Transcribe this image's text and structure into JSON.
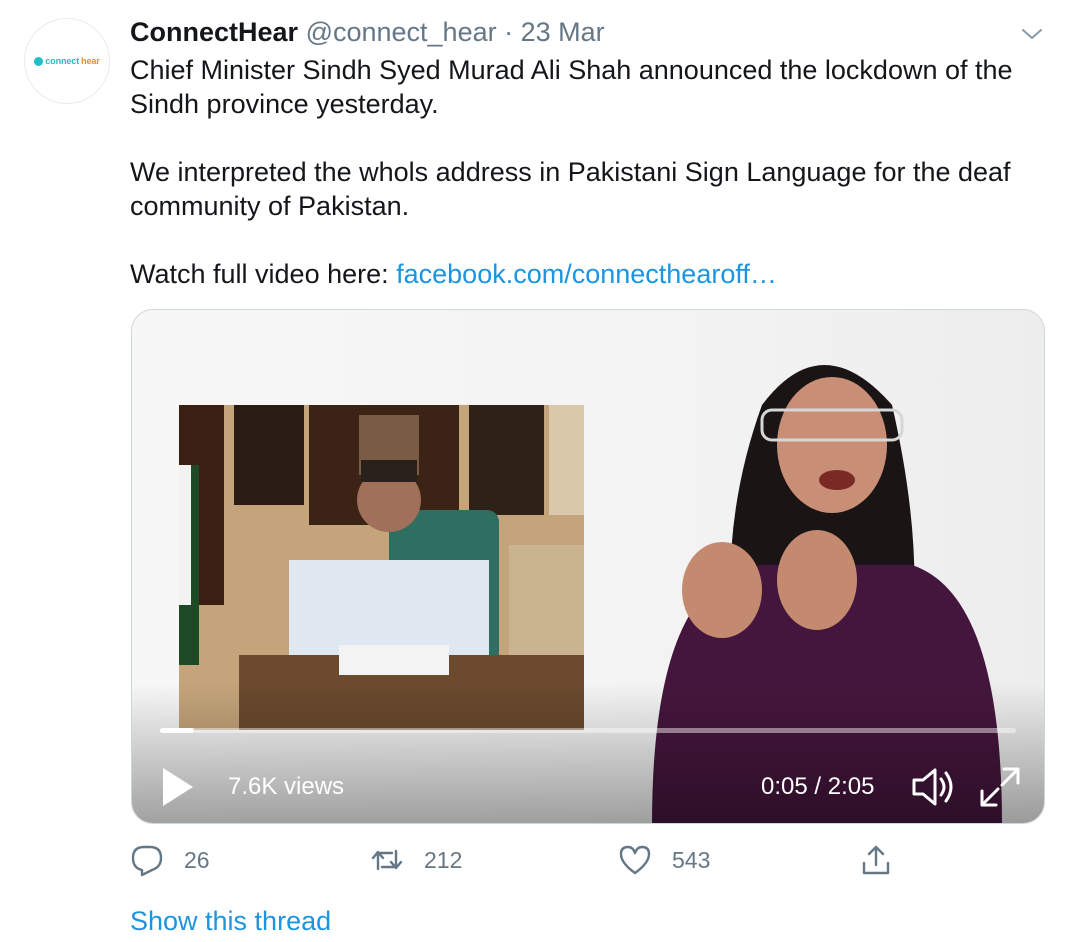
{
  "avatar": {
    "logo_part1": "connect",
    "logo_part2": "hear"
  },
  "tweet": {
    "display_name": "ConnectHear",
    "handle": "@connect_hear",
    "separator": "·",
    "date": "23 Mar",
    "paragraph1": "Chief Minister Sindh Syed Murad Ali Shah announced the lockdown of the Sindh province yesterday.",
    "paragraph2": "We interpreted the whols address in Pakistani Sign Language for the deaf community of Pakistan.",
    "paragraph3_prefix": "Watch full video here: ",
    "link_text": "facebook.com/connecthearoff…"
  },
  "video": {
    "views": "7.6K views",
    "time": "0:05 / 2:05",
    "progress_fraction": 0.04
  },
  "actions": {
    "replies": "26",
    "retweets": "212",
    "likes": "543"
  },
  "show_thread": "Show this thread",
  "icons": {
    "caret": "chevron-down-icon",
    "play": "play-icon",
    "volume": "volume-icon",
    "fullscreen": "fullscreen-icon",
    "reply": "reply-icon",
    "retweet": "retweet-icon",
    "like": "heart-icon",
    "share": "share-icon"
  },
  "colors": {
    "link": "#1b95e0",
    "muted": "#657786",
    "text": "#14171a",
    "logo_teal": "#1dbfc9",
    "logo_orange": "#f08a24"
  }
}
